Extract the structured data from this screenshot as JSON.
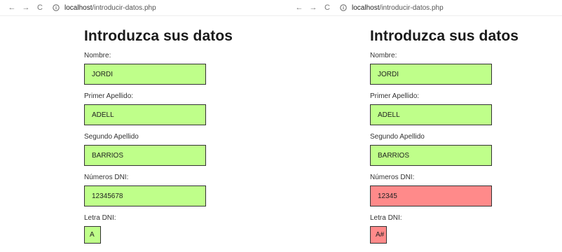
{
  "browser": {
    "url_host": "localhost",
    "url_path": "/introducir-datos.php"
  },
  "form": {
    "title": "Introduzca sus datos",
    "labels": {
      "nombre": "Nombre:",
      "primer_apellido": "Primer Apellido:",
      "segundo_apellido": "Segundo Apellido",
      "numeros_dni": "Números DNI:",
      "letra_dni": "Letra DNI:"
    }
  },
  "left": {
    "nombre": "JORDI",
    "primer_apellido": "ADELL",
    "segundo_apellido": "BARRIOS",
    "numeros_dni": "12345678",
    "letra_dni": "A"
  },
  "right": {
    "nombre": "JORDI",
    "primer_apellido": "ADELL",
    "segundo_apellido": "BARRIOS",
    "numeros_dni": "12345",
    "letra_dni": "A#"
  },
  "colors": {
    "valid": "#bfff8a",
    "invalid": "#ff8a8a"
  }
}
